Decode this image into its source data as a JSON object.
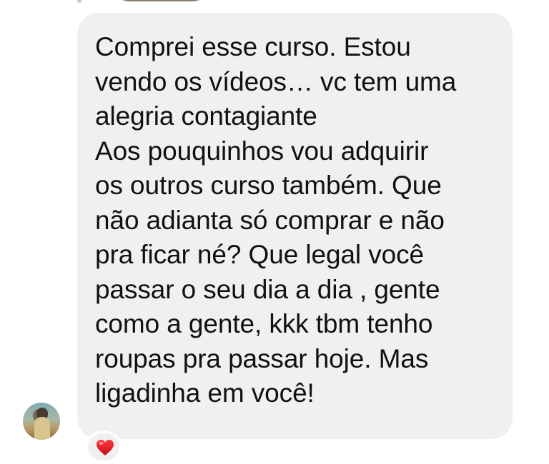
{
  "message": {
    "text": "Comprei esse curso. Estou\nvendo os vídeos… vc tem uma\nalegria contagiante\n Aos pouquinhos vou adquirir\nos outros curso também.  Que\nnão adianta só comprar e não\npra ficar né? Que legal você\npassar o seu dia a dia , gente\ncomo a gente, kkk tbm tenho\nroupas pra passar hoje. Mas\nligadinha em você!"
  },
  "reaction": {
    "icon": "heart-icon",
    "color": "#e0121f"
  },
  "colors": {
    "bubble_background": "#f0f0f2",
    "text": "#111111"
  }
}
